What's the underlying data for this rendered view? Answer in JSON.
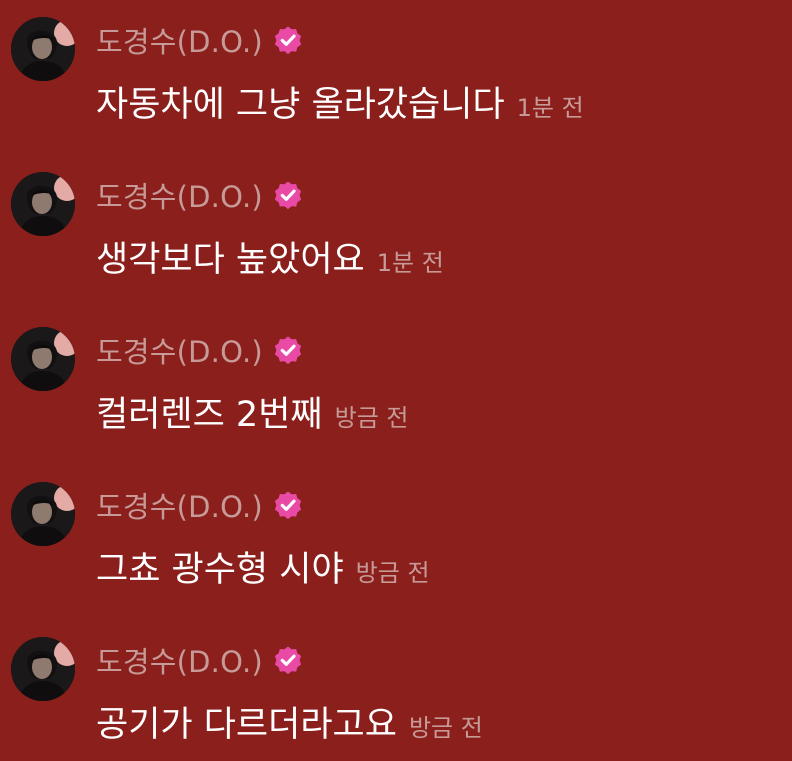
{
  "messages": [
    {
      "author": "도경수(D.O.)",
      "text": "자동차에 그냥 올라갔습니다",
      "time": "1분 전",
      "verified": true
    },
    {
      "author": "도경수(D.O.)",
      "text": "생각보다 높았어요",
      "time": "1분 전",
      "verified": true
    },
    {
      "author": "도경수(D.O.)",
      "text": "컬러렌즈 2번째",
      "time": "방금 전",
      "verified": true
    },
    {
      "author": "도경수(D.O.)",
      "text": "그쵸 광수형 시야",
      "time": "방금 전",
      "verified": true
    },
    {
      "author": "도경수(D.O.)",
      "text": "공기가 다르더라고요",
      "time": "방금 전",
      "verified": true
    }
  ],
  "colors": {
    "background": "#8a1f1c",
    "author": "#c79a97",
    "timestamp": "#c79a97",
    "message": "#ffffff",
    "verified_badge": "#e94aa6"
  },
  "icons": {
    "avatar": "avatar",
    "verified": "verified-badge-icon"
  }
}
